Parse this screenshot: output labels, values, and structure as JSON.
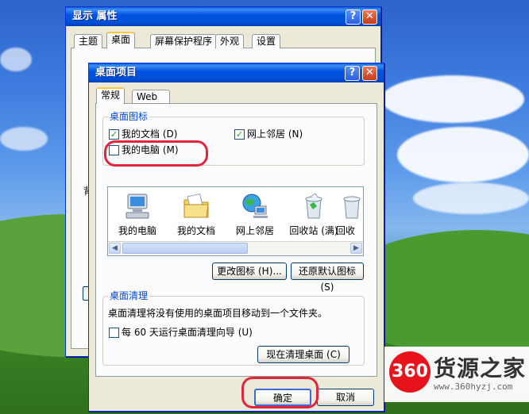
{
  "back_window": {
    "title": "显示 属性",
    "tabs": [
      "主题",
      "桌面",
      "屏幕保护程序",
      "外观",
      "设置"
    ],
    "partial_label": "背"
  },
  "dialog": {
    "title": "桌面项目",
    "tabs": [
      "常规",
      "Web"
    ],
    "desktop_icons_group": {
      "label": "桌面图标",
      "checkboxes": [
        {
          "label": "我的文档 (D)",
          "checked": true
        },
        {
          "label": "网上邻居 (N)",
          "checked": true
        },
        {
          "label": "我的电脑 (M)",
          "checked": false
        }
      ]
    },
    "icon_list": [
      {
        "label": "我的电脑",
        "icon": "my-computer-icon"
      },
      {
        "label": "我的文档",
        "icon": "my-documents-icon"
      },
      {
        "label": "网上邻居",
        "icon": "network-places-icon"
      },
      {
        "label": "回收站 (满)",
        "icon": "recycle-bin-icon"
      },
      {
        "label": "回收",
        "icon": "recycle-bin-icon"
      }
    ],
    "change_icon_button": "更改图标 (H)...",
    "restore_default_button": "还原默认图标 (S)",
    "cleanup_group": {
      "label": "桌面清理",
      "description": "桌面清理将没有使用的桌面项目移动到一个文件夹。",
      "checkbox_label": "每 60 天运行桌面清理向导 (U)",
      "checked": false,
      "cleanup_now_button": "现在清理桌面 (C)"
    },
    "ok_button": "确定",
    "cancel_button": "取消"
  },
  "watermark": {
    "logo_text": "360",
    "title": "货源之家",
    "url": "www.360hyzj.com"
  },
  "colors": {
    "title_blue": "#0054e3",
    "highlight_red": "#e0263c",
    "group_label_blue": "#0046d5"
  }
}
